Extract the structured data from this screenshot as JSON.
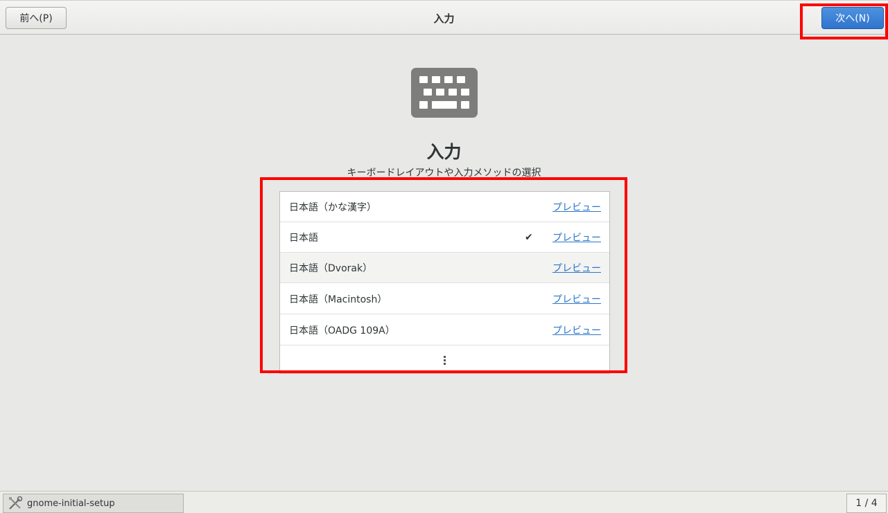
{
  "header": {
    "prev_label": "前へ(P)",
    "title": "入力",
    "next_label": "次へ(N)"
  },
  "main": {
    "icon": "keyboard-icon",
    "title": "入力",
    "subtitle": "キーボードレイアウトや入力メソッドの選択"
  },
  "list": {
    "items": [
      {
        "label": "日本語（かな漢字）",
        "checked": false,
        "preview": "プレビュー"
      },
      {
        "label": "日本語",
        "checked": true,
        "check_mark": "✔",
        "preview": "プレビュー"
      },
      {
        "label": "日本語（Dvorak）",
        "checked": false,
        "preview": "プレビュー"
      },
      {
        "label": "日本語（Macintosh）",
        "checked": false,
        "preview": "プレビュー"
      },
      {
        "label": "日本語（OADG 109A）",
        "checked": false,
        "preview": "プレビュー"
      }
    ],
    "more_icon": "more-vertical-icon"
  },
  "taskbar": {
    "task_label": "gnome-initial-setup",
    "task_icon": "tools-icon",
    "workspace": "1 / 4"
  },
  "colors": {
    "accent": "#2f74cc",
    "link": "#2a76c6",
    "highlight": "#ff0000",
    "background": "#e8e8e7"
  }
}
